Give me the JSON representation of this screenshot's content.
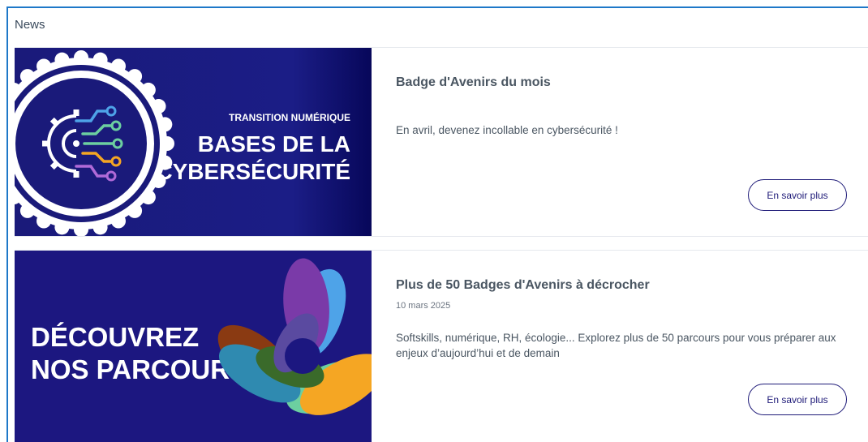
{
  "panel": {
    "title": "News"
  },
  "cards": [
    {
      "image": {
        "kicker": "TRANSITION NUMÉRIQUE",
        "line1": "BASES DE LA",
        "line2": "CYBERSÉCURITÉ",
        "icon": "gear-circuit-icon",
        "background": "#1a1a7a"
      },
      "title": "Badge d'Avenirs du mois",
      "date": "",
      "description": "En avril, devenez incollable en cybersécurité !",
      "button_label": "En savoir plus"
    },
    {
      "image": {
        "line1": "DÉCOUVREZ",
        "line2": "NOS PARCOURS",
        "icon": "colorful-swirl-icon",
        "background": "#1c1780"
      },
      "title": "Plus de 50 Badges d'Avenirs à décrocher",
      "date": "10 mars 2025",
      "description": "Softskills, numérique, RH, écologie... Explorez plus de 50 parcours pour vous préparer aux enjeux d’aujourd’hui et de demain",
      "button_label": "En savoir plus"
    }
  ],
  "colors": {
    "panel_border": "#1e78c8",
    "button_border": "#1e1a78",
    "text": "#4a5662"
  }
}
